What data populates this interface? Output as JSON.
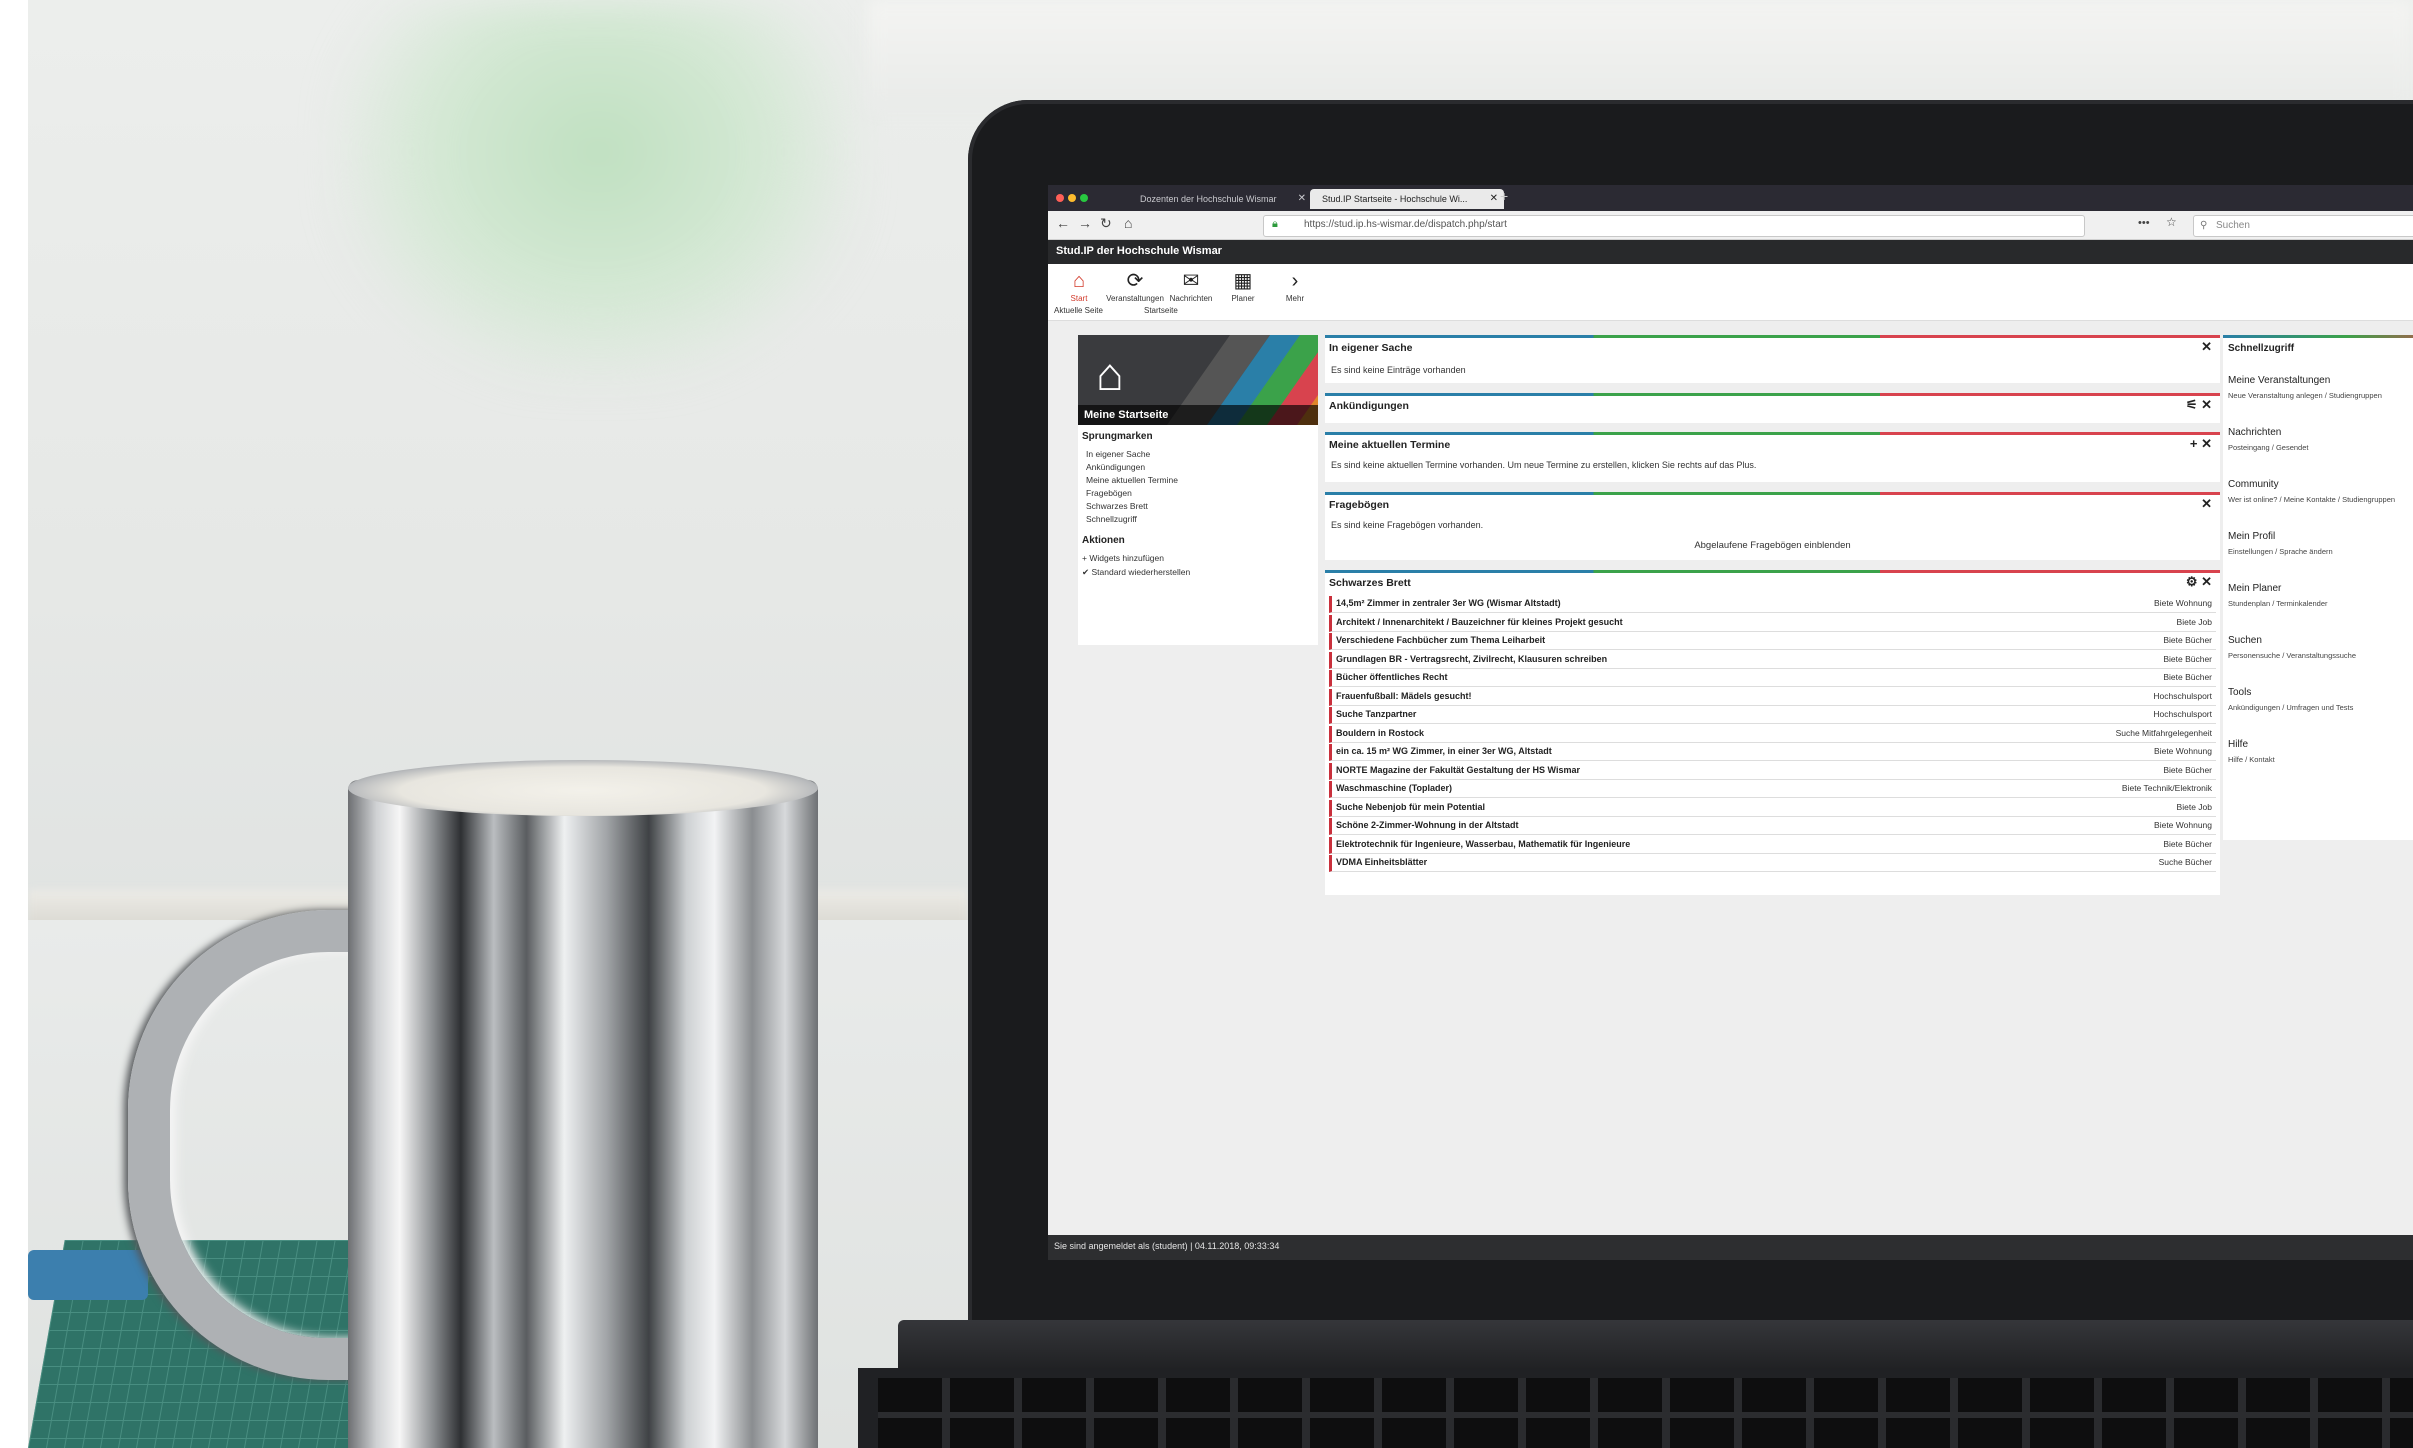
{
  "browser": {
    "tabs": [
      {
        "label": "Dozenten der Hochschule Wismar"
      },
      {
        "label": "Stud.IP Startseite - Hochschule Wi..."
      }
    ],
    "url": "https://stud.ip.hs-wismar.de/dispatch.php/start",
    "search_placeholder": "Suchen"
  },
  "app": {
    "brand": "Stud.IP der Hochschule Wismar",
    "nav": [
      {
        "label": "Start",
        "icon": "home-icon",
        "glyph": "⌂"
      },
      {
        "label": "Veranstaltungen",
        "icon": "courses-icon",
        "glyph": "⟳"
      },
      {
        "label": "Nachrichten",
        "icon": "mail-icon",
        "glyph": "✉"
      },
      {
        "label": "Planer",
        "icon": "calendar-icon",
        "glyph": "▦"
      },
      {
        "label": "Mehr",
        "icon": "chevron-right-icon",
        "glyph": "›"
      }
    ],
    "subnav": [
      "Aktuelle Seite",
      "Startseite"
    ]
  },
  "sidebar": {
    "banner_title": "Meine Startseite",
    "jump_heading": "Sprungmarken",
    "jump_links": [
      "In eigener Sache",
      "Ankündigungen",
      "Meine aktuellen Termine",
      "Fragebögen",
      "Schwarzes Brett",
      "Schnellzugriff"
    ],
    "actions_heading": "Aktionen",
    "actions": [
      "Widgets hinzufügen",
      "Standard wiederherstellen"
    ]
  },
  "widgets": {
    "own": {
      "title": "In eigener Sache",
      "text": "Es sind keine Einträge vorhanden",
      "tools": "✕"
    },
    "news": {
      "title": "Ankündigungen",
      "tools": "⚟ ✕"
    },
    "dates": {
      "title": "Meine aktuellen Termine",
      "text": "Es sind keine aktuellen Termine vorhanden. Um neue Termine zu erstellen, klicken Sie rechts auf das Plus.",
      "tools": "+ ✕"
    },
    "surveys": {
      "title": "Fragebögen",
      "text": "Es sind keine Fragebögen vorhanden.",
      "link": "Abgelaufene Fragebögen einblenden",
      "tools": "✕"
    },
    "board": {
      "title": "Schwarzes Brett",
      "tools": "⚙ ✕",
      "rows": [
        {
          "title": "14,5m² Zimmer in zentraler 3er WG (Wismar Altstadt)",
          "category": "Biete Wohnung"
        },
        {
          "title": "Architekt / Innenarchitekt / Bauzeichner für kleines Projekt gesucht",
          "category": "Biete Job"
        },
        {
          "title": "Verschiedene Fachbücher zum Thema Leiharbeit",
          "category": "Biete Bücher"
        },
        {
          "title": "Grundlagen BR - Vertragsrecht, Zivilrecht, Klausuren schreiben",
          "category": "Biete Bücher"
        },
        {
          "title": "Bücher öffentliches Recht",
          "category": "Biete Bücher"
        },
        {
          "title": "Frauenfußball: Mädels gesucht!",
          "category": "Hochschulsport"
        },
        {
          "title": "Suche Tanzpartner",
          "category": "Hochschulsport"
        },
        {
          "title": "Bouldern in Rostock",
          "category": "Suche Mitfahrgelegenheit"
        },
        {
          "title": "ein ca. 15 m² WG Zimmer, in einer 3er WG, Altstadt",
          "category": "Biete Wohnung"
        },
        {
          "title": "NORTE Magazine der Fakultät Gestaltung der HS Wismar",
          "category": "Biete Bücher"
        },
        {
          "title": "Waschmaschine (Toplader)",
          "category": "Biete Technik/Elektronik"
        },
        {
          "title": "Suche Nebenjob für mein Potential",
          "category": "Biete Job"
        },
        {
          "title": "Schöne 2-Zimmer-Wohnung in der Altstadt",
          "category": "Biete Wohnung"
        },
        {
          "title": "Elektrotechnik für Ingenieure, Wasserbau, Mathematik für Ingenieure",
          "category": "Biete Bücher"
        },
        {
          "title": "VDMA Einheitsblätter",
          "category": "Suche Bücher"
        }
      ]
    }
  },
  "quick_access": {
    "title": "Schnellzugriff",
    "items": [
      {
        "h": "Meine Veranstaltungen",
        "s": "Neue Veranstaltung anlegen / Studiengruppen"
      },
      {
        "h": "Nachrichten",
        "s": "Posteingang / Gesendet"
      },
      {
        "h": "Community",
        "s": "Wer ist online? / Meine Kontakte / Studiengruppen"
      },
      {
        "h": "Mein Profil",
        "s": "Einstellungen / Sprache ändern"
      },
      {
        "h": "Mein Planer",
        "s": "Stundenplan / Terminkalender"
      },
      {
        "h": "Suchen",
        "s": "Personensuche / Veranstaltungssuche"
      },
      {
        "h": "Tools",
        "s": "Ankündigungen / Umfragen und Tests"
      },
      {
        "h": "Hilfe",
        "s": "Hilfe / Kontakt"
      }
    ]
  },
  "status": {
    "text": "Sie sind angemeldet als (student) | 04.11.2018, 09:33:34"
  },
  "colors": {
    "accent_red": "#d23a2b",
    "stripe_blue": "#2a7fa8",
    "stripe_green": "#3ba24a",
    "stripe_red": "#d8434e"
  }
}
